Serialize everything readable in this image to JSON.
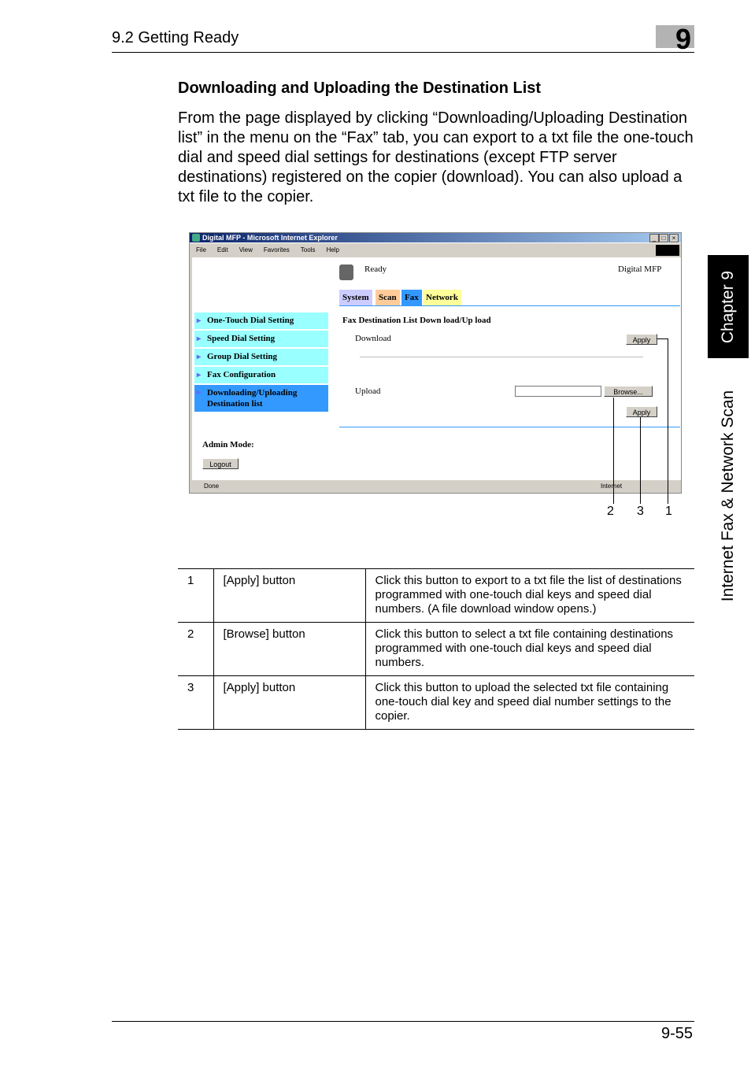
{
  "header": {
    "section": "9.2 Getting Ready",
    "chapter_number": "9"
  },
  "heading": "Downloading and Uploading the Destination List",
  "paragraph": "From the page displayed by clicking “Downloading/Uploading Destination list” in the menu on the “Fax” tab, you can export to a txt file the one-touch dial and speed dial settings for destinations (except FTP server destinations) registered on the copier (download). You can also upload a txt file to the copier.",
  "browser": {
    "title": "Digital MFP - Microsoft Internet Explorer",
    "menu": [
      "File",
      "Edit",
      "View",
      "Favorites",
      "Tools",
      "Help"
    ],
    "status_ready": "Ready",
    "device": "Digital MFP",
    "tabs": [
      {
        "label": "System",
        "color": "#ccccff"
      },
      {
        "label": "Scan",
        "color": "#ffcc99"
      },
      {
        "label": "Fax",
        "color": "#3399ff"
      },
      {
        "label": "Network",
        "color": "#ffff99"
      }
    ],
    "sidebar": [
      "One-Touch Dial Setting",
      "Speed Dial Setting",
      "Group Dial Setting",
      "Fax Configuration"
    ],
    "sidebar_active": [
      "Downloading/Uploading",
      "Destination list"
    ],
    "page_title": "Fax Destination List Down load/Up load",
    "download_label": "Download",
    "apply": "Apply",
    "upload_label": "Upload",
    "upload_value": "",
    "browse": "Browse...",
    "admin_mode": "Admin Mode:",
    "logout": "Logout",
    "statusbar_left": "Done",
    "statusbar_zone": "Internet"
  },
  "callouts": [
    "2",
    "3",
    "1"
  ],
  "table": [
    {
      "num": "1",
      "item": "[Apply] button",
      "desc": "Click this button to export to a txt file the list of destinations programmed with one-touch dial keys and speed dial numbers. (A file download window opens.)"
    },
    {
      "num": "2",
      "item": "[Browse] button",
      "desc": "Click this button to select a txt file containing destinations programmed with one-touch dial keys and speed dial numbers."
    },
    {
      "num": "3",
      "item": "[Apply] button",
      "desc": "Click this button to upload the selected txt file containing one-touch dial key and speed dial number settings to the copier."
    }
  ],
  "side_tab": {
    "chapter": "Chapter 9",
    "title": "Internet Fax & Network Scan"
  },
  "footer": {
    "page": "9-55"
  }
}
